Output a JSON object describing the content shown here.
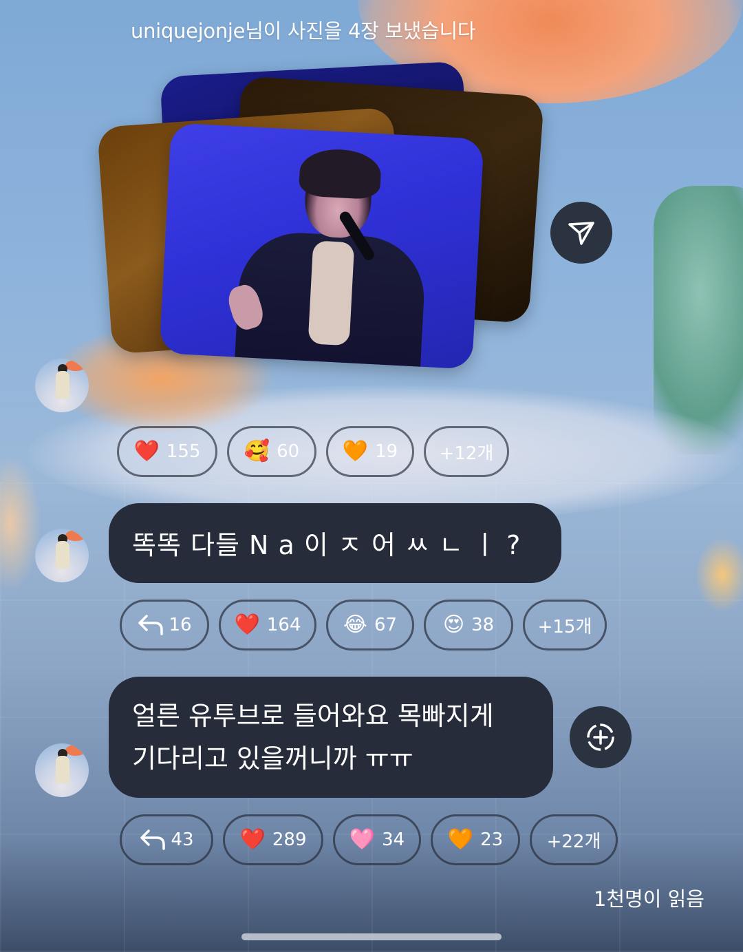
{
  "header": {
    "notice": "uniquejonje님이 사진을 4장 보냈습니다"
  },
  "message1": {
    "type": "photo_stack",
    "photo_count": 4,
    "reactions": [
      {
        "icon": "red-heart-icon",
        "emoji": "❤️",
        "count": "155"
      },
      {
        "icon": "smiling-face-with-hearts-icon",
        "emoji": "🥰",
        "count": "60"
      },
      {
        "icon": "orange-heart-icon",
        "emoji": "🧡",
        "count": "19"
      },
      {
        "more": "+12개"
      }
    ]
  },
  "message2": {
    "text": "똑똑 다들 N a 이 ㅈ 어 ㅆ ㄴ ㅣ ?",
    "reply_count": "16",
    "reactions": [
      {
        "icon": "red-heart-icon",
        "emoji": "❤️",
        "count": "164"
      },
      {
        "icon": "tears-of-joy-icon",
        "emoji": "😂",
        "count": "67"
      },
      {
        "icon": "heart-eyes-icon",
        "emoji": "😍",
        "count": "38"
      },
      {
        "more": "+15개"
      }
    ]
  },
  "message3": {
    "line1": "얼른 유투브로 들어와요 목빠지게",
    "line2": "기다리고 있을꺼니까 ㅠㅠ",
    "reply_count": "43",
    "reactions": [
      {
        "icon": "red-heart-icon",
        "emoji": "❤️",
        "count": "289"
      },
      {
        "icon": "pink-heart-icon",
        "emoji": "🩷",
        "count": "34"
      },
      {
        "icon": "orange-heart-icon",
        "emoji": "🧡",
        "count": "23"
      },
      {
        "more": "+22개"
      }
    ]
  },
  "footer": {
    "read_status": "1천명이 읽음"
  },
  "colors": {
    "bubble": "#262c3a",
    "button": "#2b3240",
    "text": "#ffffff"
  }
}
